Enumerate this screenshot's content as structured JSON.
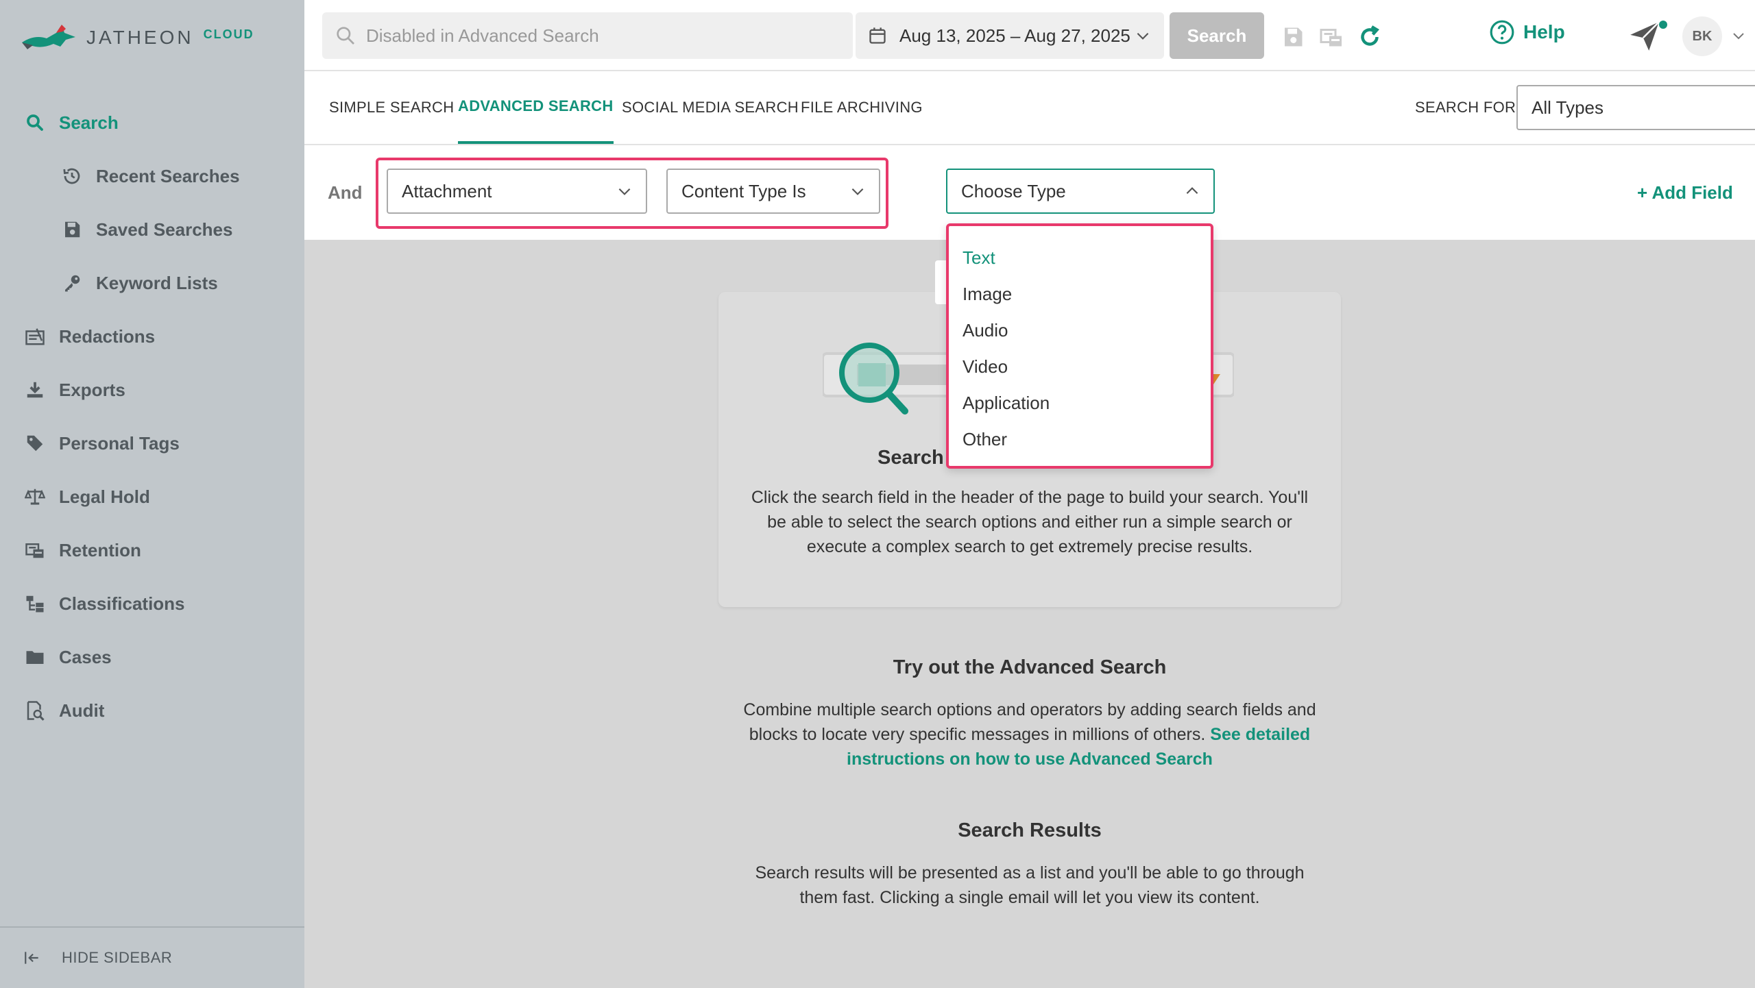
{
  "brand": {
    "name": "JATHEON",
    "suffix": "CLOUD"
  },
  "sidebar": {
    "items": [
      {
        "label": "Search",
        "icon": "search-icon",
        "active": true
      },
      {
        "label": "Recent Searches",
        "icon": "history-icon"
      },
      {
        "label": "Saved Searches",
        "icon": "save-icon"
      },
      {
        "label": "Keyword Lists",
        "icon": "key-icon"
      },
      {
        "label": "Redactions",
        "icon": "redaction-icon"
      },
      {
        "label": "Exports",
        "icon": "download-icon"
      },
      {
        "label": "Personal Tags",
        "icon": "tag-icon"
      },
      {
        "label": "Legal Hold",
        "icon": "scale-icon"
      },
      {
        "label": "Retention",
        "icon": "retention-icon"
      },
      {
        "label": "Classifications",
        "icon": "hierarchy-icon"
      },
      {
        "label": "Cases",
        "icon": "folder-icon"
      },
      {
        "label": "Audit",
        "icon": "audit-icon"
      }
    ],
    "footer_label": "HIDE SIDEBAR"
  },
  "header": {
    "search_placeholder": "Disabled in Advanced Search",
    "date_range": "Aug 13, 2025 – Aug 27, 2025",
    "search_button": "Search",
    "help_label": "Help",
    "avatar_initials": "BK"
  },
  "tabs": [
    {
      "label": "SIMPLE SEARCH",
      "active": false
    },
    {
      "label": "ADVANCED SEARCH",
      "active": true
    },
    {
      "label": "SOCIAL MEDIA SEARCH",
      "active": false
    },
    {
      "label": "FILE ARCHIVING",
      "active": false
    }
  ],
  "search_for": {
    "label": "SEARCH FOR:",
    "value": "All Types"
  },
  "builder": {
    "operator": "And",
    "field": "Attachment",
    "condition": "Content Type Is",
    "type_placeholder": "Choose Type",
    "add_field": "+ Add Field"
  },
  "type_options": [
    "Text",
    "Image",
    "Audio",
    "Video",
    "Application",
    "Other"
  ],
  "selected_type": "Text",
  "card": {
    "title": "Search",
    "text": "Click the search field in the header of the page to build your search. You'll be able to select the search options and either run a simple search or execute a complex search to get extremely precise results."
  },
  "advanced": {
    "title": "Try out the Advanced Search",
    "text": "Combine multiple search options and operators by adding search fields and blocks to locate very specific messages in millions of others.",
    "link": "See detailed instructions on how to use Advanced Search"
  },
  "results": {
    "title": "Search Results",
    "text": "Search results will be presented as a list and you'll be able to go through them fast. Clicking a single email will let you view its content."
  },
  "colors": {
    "accent": "#13927a",
    "highlight": "#e8396b",
    "sidebar_bg": "#c1c7cb"
  }
}
